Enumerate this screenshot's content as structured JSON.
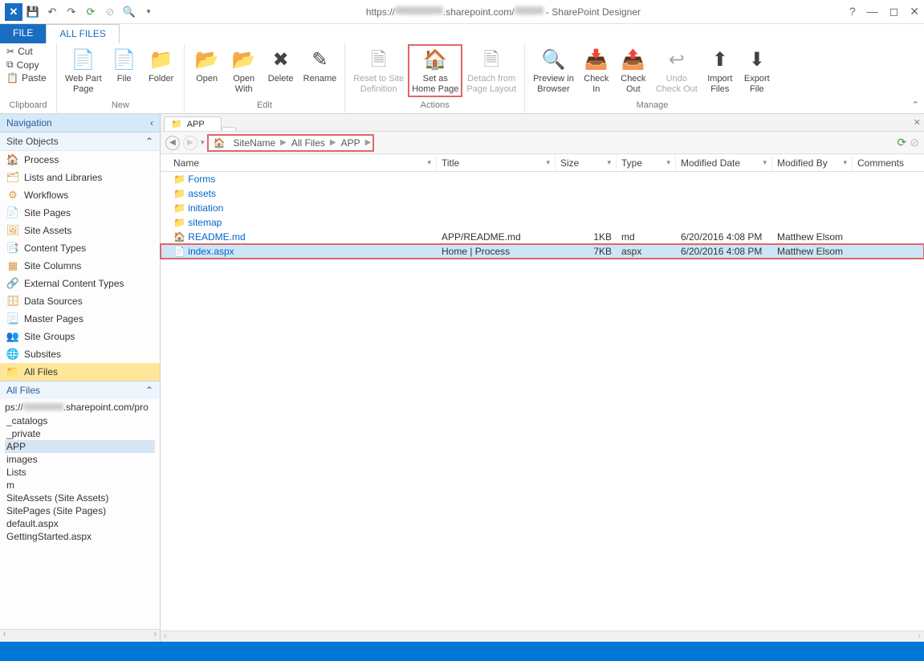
{
  "titlebar": {
    "url_prefix": "https://",
    "url_mid": ".sharepoint.com/",
    "app": "- SharePoint Designer"
  },
  "tabs": {
    "file": "FILE",
    "allfiles": "ALL FILES"
  },
  "ribbon": {
    "clipboard": {
      "cut": "Cut",
      "copy": "Copy",
      "paste": "Paste",
      "label": "Clipboard"
    },
    "new": {
      "webpart": "Web Part\nPage",
      "file": "File",
      "folder": "Folder",
      "label": "New"
    },
    "edit": {
      "open": "Open",
      "openwith": "Open\nWith",
      "delete": "Delete",
      "rename": "Rename",
      "label": "Edit"
    },
    "actions": {
      "reset": "Reset to Site\nDefinition",
      "sethome": "Set as\nHome Page",
      "detach": "Detach from\nPage Layout",
      "label": "Actions"
    },
    "manage": {
      "preview": "Preview in\nBrowser",
      "checkin": "Check\nIn",
      "checkout": "Check\nOut",
      "undo": "Undo\nCheck Out",
      "import": "Import\nFiles",
      "export": "Export\nFile",
      "label": "Manage"
    }
  },
  "nav": {
    "header": "Navigation",
    "siteobjects": "Site Objects",
    "items": [
      "Process",
      "Lists and Libraries",
      "Workflows",
      "Site Pages",
      "Site Assets",
      "Content Types",
      "Site Columns",
      "External Content Types",
      "Data Sources",
      "Master Pages",
      "Site Groups",
      "Subsites",
      "All Files"
    ],
    "allfiles_hdr": "All Files",
    "tree_url": "ps://",
    "tree_url2": ".sharepoint.com/pro",
    "tree": [
      "_catalogs",
      "_private",
      "APP",
      "images",
      "Lists",
      "m",
      "SiteAssets (Site Assets)",
      "SitePages (Site Pages)",
      "default.aspx",
      "GettingStarted.aspx"
    ]
  },
  "content": {
    "tab": "APP",
    "crumbs": [
      "SiteName",
      "All Files",
      "APP"
    ],
    "columns": [
      "Name",
      "Title",
      "Size",
      "Type",
      "Modified Date",
      "Modified By",
      "Comments"
    ],
    "rows": [
      {
        "icon": "folder",
        "name": "Forms",
        "link": true
      },
      {
        "icon": "folder",
        "name": "assets",
        "link": true
      },
      {
        "icon": "folder",
        "name": "initiation",
        "link": true
      },
      {
        "icon": "folder",
        "name": "sitemap",
        "link": true
      },
      {
        "icon": "home",
        "name": "README.md",
        "link": true,
        "title": "APP/README.md",
        "size": "1KB",
        "type": "md",
        "date": "6/20/2016 4:08 PM",
        "by": "Matthew Elsom"
      },
      {
        "icon": "aspx",
        "name": "index.aspx",
        "link": true,
        "title": "Home | Process",
        "size": "7KB",
        "type": "aspx",
        "date": "6/20/2016 4:08 PM",
        "by": "Matthew Elsom",
        "selected": true,
        "marked": true
      }
    ]
  }
}
